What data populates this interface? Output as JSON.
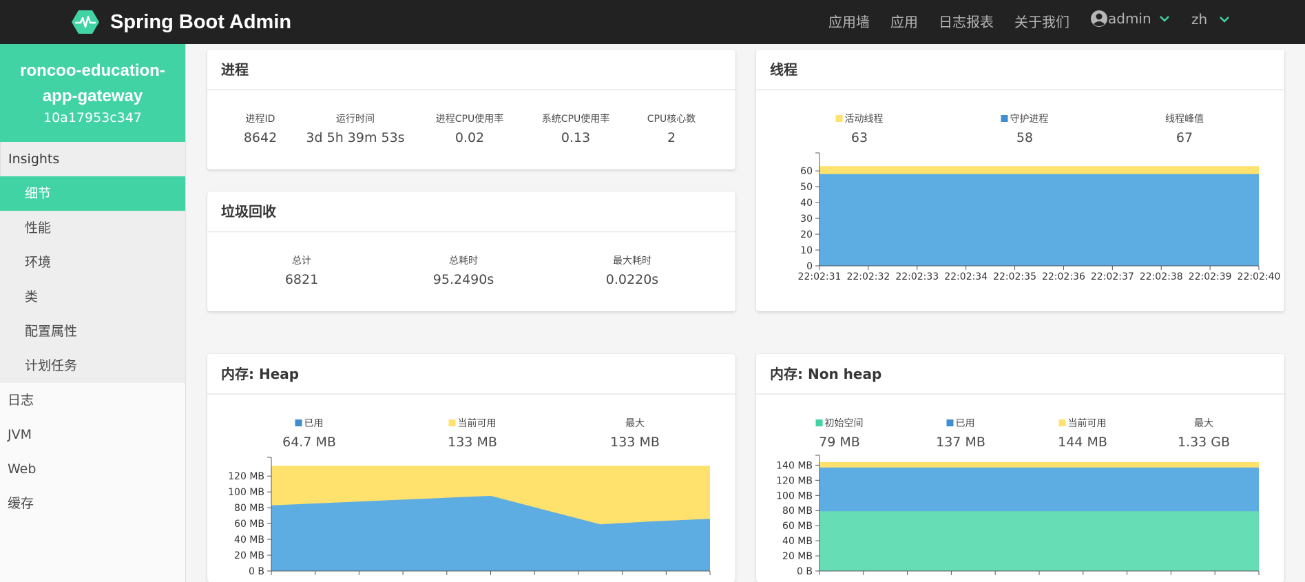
{
  "navbar": {
    "title": "Spring Boot Admin",
    "links": [
      "应用墙",
      "应用",
      "日志报表",
      "关于我们"
    ],
    "user": "admin",
    "lang": "zh"
  },
  "sidebar": {
    "app_name_line1": "roncoo-education-",
    "app_name_line2": "app-gateway",
    "app_id": "10a17953c347",
    "section": "Insights",
    "sub_items": [
      "细节",
      "性能",
      "环境",
      "类",
      "配置属性",
      "计划任务"
    ],
    "active_index": 0,
    "items": [
      "日志",
      "JVM",
      "Web",
      "缓存"
    ]
  },
  "process": {
    "title": "进程",
    "stats": [
      {
        "label": "进程ID",
        "value": "8642"
      },
      {
        "label": "运行时间",
        "value": "3d 5h 39m 53s"
      },
      {
        "label": "进程CPU使用率",
        "value": "0.02"
      },
      {
        "label": "系统CPU使用率",
        "value": "0.13"
      },
      {
        "label": "CPU核心数",
        "value": "2"
      }
    ]
  },
  "gc": {
    "title": "垃圾回收",
    "stats": [
      {
        "label": "总计",
        "value": "6821"
      },
      {
        "label": "总耗时",
        "value": "95.2490s"
      },
      {
        "label": "最大耗时",
        "value": "0.0220s"
      }
    ]
  },
  "threads": {
    "title": "线程",
    "stats": [
      {
        "label": "活动线程",
        "value": "63",
        "color": "#ffe16d"
      },
      {
        "label": "守护进程",
        "value": "58",
        "color": "#3e8ed0"
      },
      {
        "label": "线程峰值",
        "value": "67",
        "color": ""
      }
    ]
  },
  "heap": {
    "title": "内存: Heap",
    "stats": [
      {
        "label": "已用",
        "value": "64.7 MB",
        "color": "#3e8ed0"
      },
      {
        "label": "当前可用",
        "value": "133 MB",
        "color": "#ffe16d"
      },
      {
        "label": "最大",
        "value": "133 MB",
        "color": ""
      }
    ]
  },
  "nonheap": {
    "title": "内存: Non heap",
    "stats": [
      {
        "label": "初始空间",
        "value": "79 MB",
        "color": "#42d3a5"
      },
      {
        "label": "已用",
        "value": "137 MB",
        "color": "#3e8ed0"
      },
      {
        "label": "当前可用",
        "value": "144 MB",
        "color": "#ffe16d"
      },
      {
        "label": "最大",
        "value": "1.33 GB",
        "color": ""
      }
    ]
  },
  "colors": {
    "accent": "#42d3a5",
    "used_fill": "#5dade2",
    "available_fill": "#ffe16d",
    "initial_fill": "#66ddb5",
    "navbar": "#222222"
  },
  "chart_data": [
    {
      "type": "area",
      "title": "线程",
      "x": [
        "22:02:31",
        "22:02:32",
        "22:02:33",
        "22:02:34",
        "22:02:35",
        "22:02:36",
        "22:02:37",
        "22:02:38",
        "22:02:39",
        "22:02:40"
      ],
      "yticks": [
        "0",
        "10",
        "20",
        "30",
        "40",
        "50",
        "60"
      ],
      "ylim": [
        0,
        67
      ],
      "series": [
        {
          "name": "守护进程",
          "values": [
            58,
            58,
            58,
            58,
            58,
            58,
            58,
            58,
            58,
            58,
            58
          ],
          "color": "#5dade2"
        },
        {
          "name": "活动线程",
          "values": [
            63,
            63,
            63,
            63,
            63,
            63,
            63,
            63,
            63,
            63,
            63
          ],
          "color": "#ffe16d"
        }
      ]
    },
    {
      "type": "area",
      "title": "内存: Heap",
      "yticks": [
        "0 B",
        "20 MB",
        "40 MB",
        "60 MB",
        "80 MB",
        "100 MB",
        "120 MB"
      ],
      "ylim": [
        0,
        135
      ],
      "series": [
        {
          "name": "已用",
          "values": [
            83,
            86,
            89,
            92,
            95,
            77,
            59,
            63,
            66
          ],
          "color": "#5dade2"
        },
        {
          "name": "当前可用",
          "values": [
            133,
            133,
            133,
            133,
            133,
            133,
            133,
            133,
            133
          ],
          "color": "#ffe16d"
        }
      ]
    },
    {
      "type": "area",
      "title": "内存: Non heap",
      "yticks": [
        "0 B",
        "20 MB",
        "40 MB",
        "60 MB",
        "80 MB",
        "100 MB",
        "120 MB",
        "140 MB"
      ],
      "ylim": [
        0,
        144
      ],
      "series": [
        {
          "name": "初始空间",
          "values": [
            79,
            79,
            79,
            79,
            79,
            79,
            79,
            79,
            79,
            79,
            79
          ],
          "color": "#66ddb5"
        },
        {
          "name": "已用",
          "values": [
            137,
            137,
            137,
            137,
            137,
            137,
            137,
            137,
            137,
            137,
            137
          ],
          "color": "#5dade2"
        },
        {
          "name": "当前可用",
          "values": [
            144,
            144,
            144,
            144,
            144,
            144,
            144,
            144,
            144,
            144,
            144
          ],
          "color": "#ffe16d"
        }
      ]
    }
  ]
}
